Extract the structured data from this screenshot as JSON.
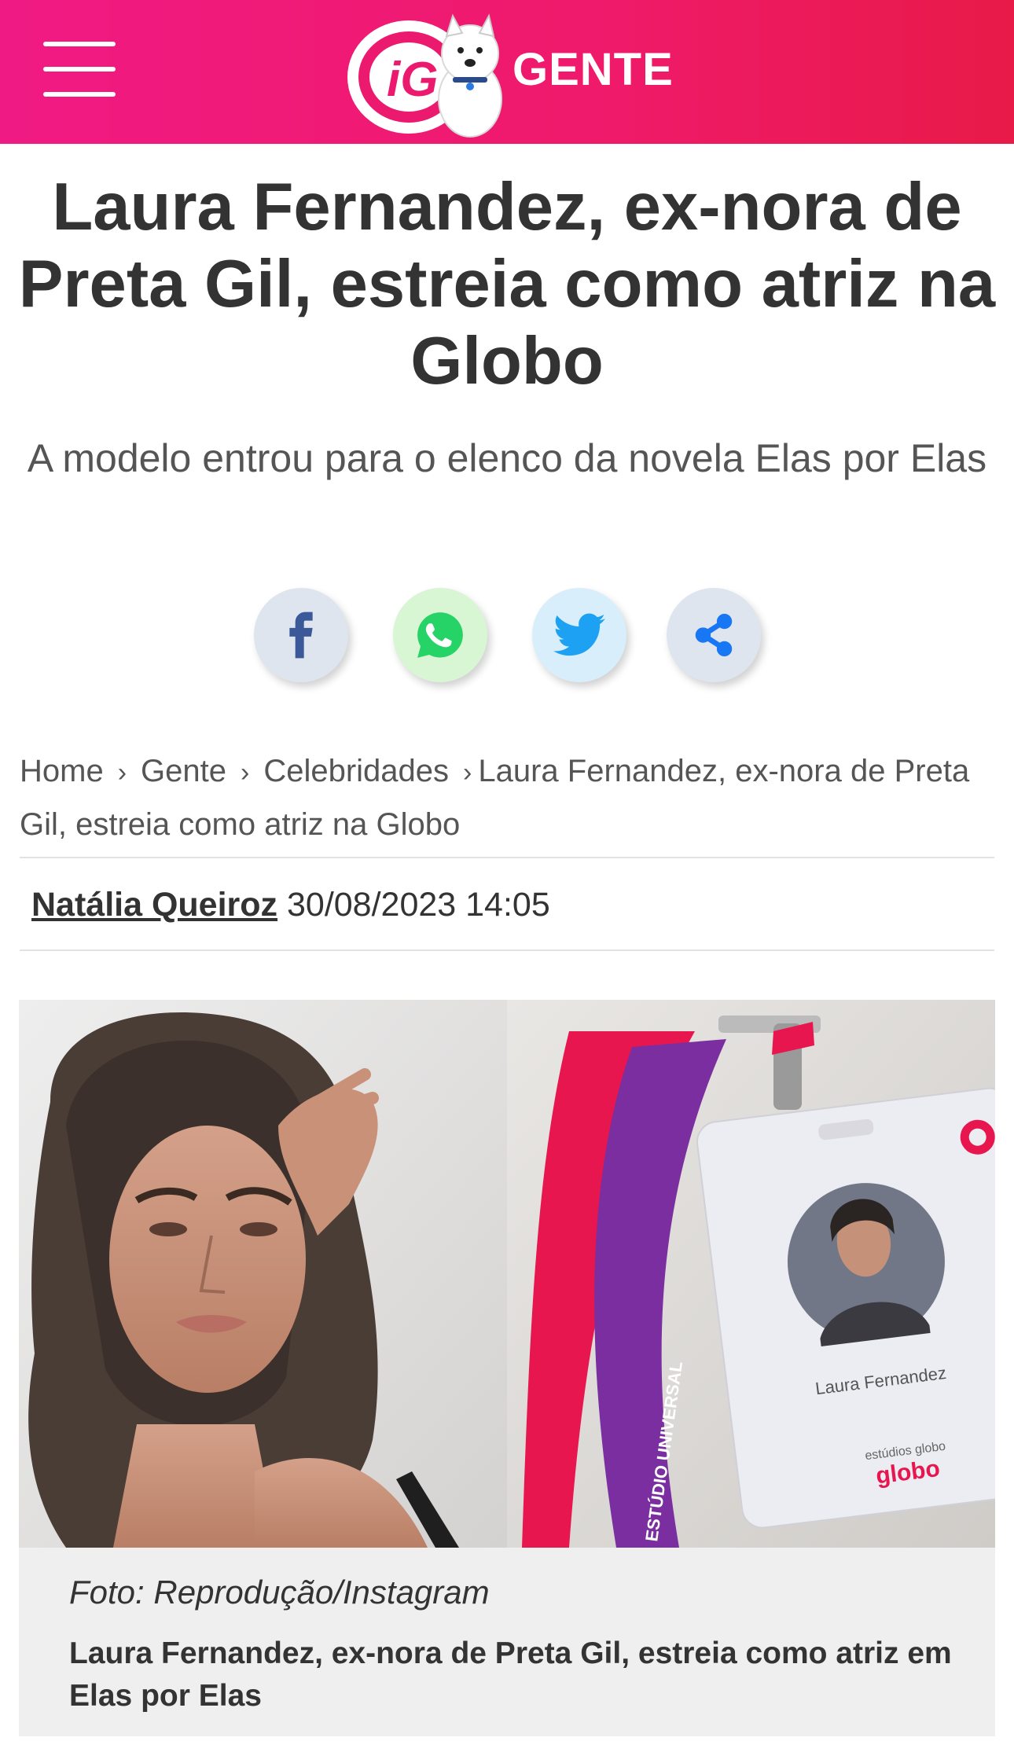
{
  "header": {
    "logo_text": "iG",
    "section": "GENTE",
    "menu_icon": "hamburger-menu-icon"
  },
  "article": {
    "title": "Laura Fernandez, ex-nora de Preta Gil, estreia como atriz na Globo",
    "subtitle": "A modelo entrou para o elenco da novela Elas por Elas"
  },
  "share": {
    "icons": [
      "facebook-icon",
      "whatsapp-icon",
      "twitter-icon",
      "share-icon"
    ],
    "colors": {
      "facebook": "#3b5998",
      "whatsapp": "#25d366",
      "twitter": "#1da1f2",
      "share": "#1877f2"
    }
  },
  "breadcrumb": {
    "items": [
      "Home",
      "Gente",
      "Celebridades",
      "Laura Fernandez, ex-nora de Preta Gil, estreia como atriz na Globo"
    ],
    "separator": "›"
  },
  "byline": {
    "author": "Natália Queiroz",
    "datetime": "30/08/2023 14:05"
  },
  "photo": {
    "badge_name": "Laura Fernandez",
    "badge_brand_small": "estúdios globo",
    "badge_brand": "globo",
    "lanyard_text": "ESTÚDIO UNIVERSAL",
    "credit": "Foto: Reprodução/Instagram",
    "caption": "Laura Fernandez, ex-nora de Preta Gil, estreia como atriz em Elas por Elas"
  },
  "colors": {
    "header_start": "#f01a84",
    "header_end": "#e81a48",
    "text": "#333333"
  }
}
